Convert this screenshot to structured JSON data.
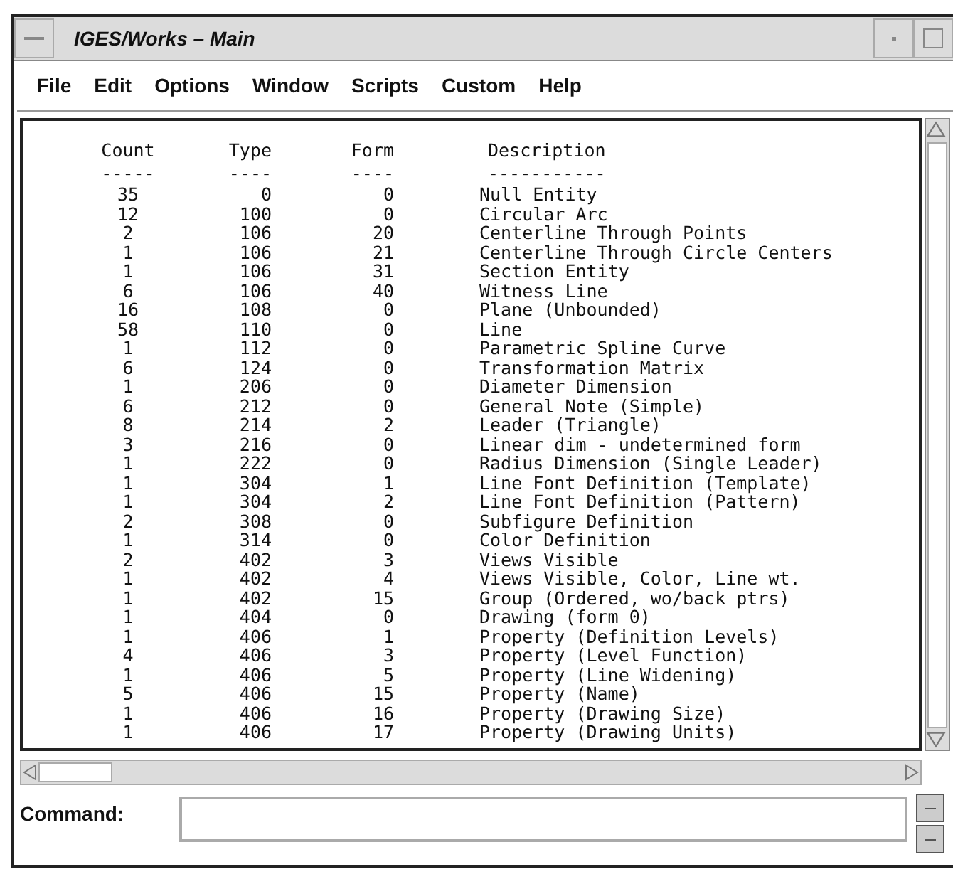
{
  "window": {
    "title": "IGES/Works – Main"
  },
  "menu": [
    "File",
    "Edit",
    "Options",
    "Window",
    "Scripts",
    "Custom",
    "Help"
  ],
  "table": {
    "columns": [
      {
        "label": "Count",
        "rule": "-----"
      },
      {
        "label": "Type",
        "rule": "----"
      },
      {
        "label": "Form",
        "rule": "----"
      },
      {
        "label": "Description",
        "rule": "-----------"
      }
    ],
    "rows": [
      [
        "35",
        "0",
        "0",
        "Null Entity"
      ],
      [
        "12",
        "100",
        "0",
        "Circular Arc"
      ],
      [
        "2",
        "106",
        "20",
        "Centerline Through Points"
      ],
      [
        "1",
        "106",
        "21",
        "Centerline Through Circle Centers"
      ],
      [
        "1",
        "106",
        "31",
        "Section Entity"
      ],
      [
        "6",
        "106",
        "40",
        "Witness Line"
      ],
      [
        "16",
        "108",
        "0",
        "Plane (Unbounded)"
      ],
      [
        "58",
        "110",
        "0",
        "Line"
      ],
      [
        "1",
        "112",
        "0",
        "Parametric Spline Curve"
      ],
      [
        "6",
        "124",
        "0",
        "Transformation Matrix"
      ],
      [
        "1",
        "206",
        "0",
        "Diameter Dimension"
      ],
      [
        "6",
        "212",
        "0",
        "General Note (Simple)"
      ],
      [
        "8",
        "214",
        "2",
        "Leader (Triangle)"
      ],
      [
        "3",
        "216",
        "0",
        "Linear dim - undetermined form"
      ],
      [
        "1",
        "222",
        "0",
        "Radius Dimension (Single Leader)"
      ],
      [
        "1",
        "304",
        "1",
        "Line Font Definition (Template)"
      ],
      [
        "1",
        "304",
        "2",
        "Line Font Definition (Pattern)"
      ],
      [
        "2",
        "308",
        "0",
        "Subfigure Definition"
      ],
      [
        "1",
        "314",
        "0",
        "Color Definition"
      ],
      [
        "2",
        "402",
        "3",
        "Views Visible"
      ],
      [
        "1",
        "402",
        "4",
        "Views Visible, Color, Line wt."
      ],
      [
        "1",
        "402",
        "15",
        "Group (Ordered, wo/back ptrs)"
      ],
      [
        "1",
        "404",
        "0",
        "Drawing (form 0)"
      ],
      [
        "1",
        "406",
        "1",
        "Property (Definition Levels)"
      ],
      [
        "4",
        "406",
        "3",
        "Property (Level Function)"
      ],
      [
        "1",
        "406",
        "5",
        "Property (Line Widening)"
      ],
      [
        "5",
        "406",
        "15",
        "Property (Name)"
      ],
      [
        "1",
        "406",
        "16",
        "Property (Drawing Size)"
      ],
      [
        "1",
        "406",
        "17",
        "Property (Drawing Units)"
      ]
    ]
  },
  "command": {
    "label": "Command:"
  }
}
